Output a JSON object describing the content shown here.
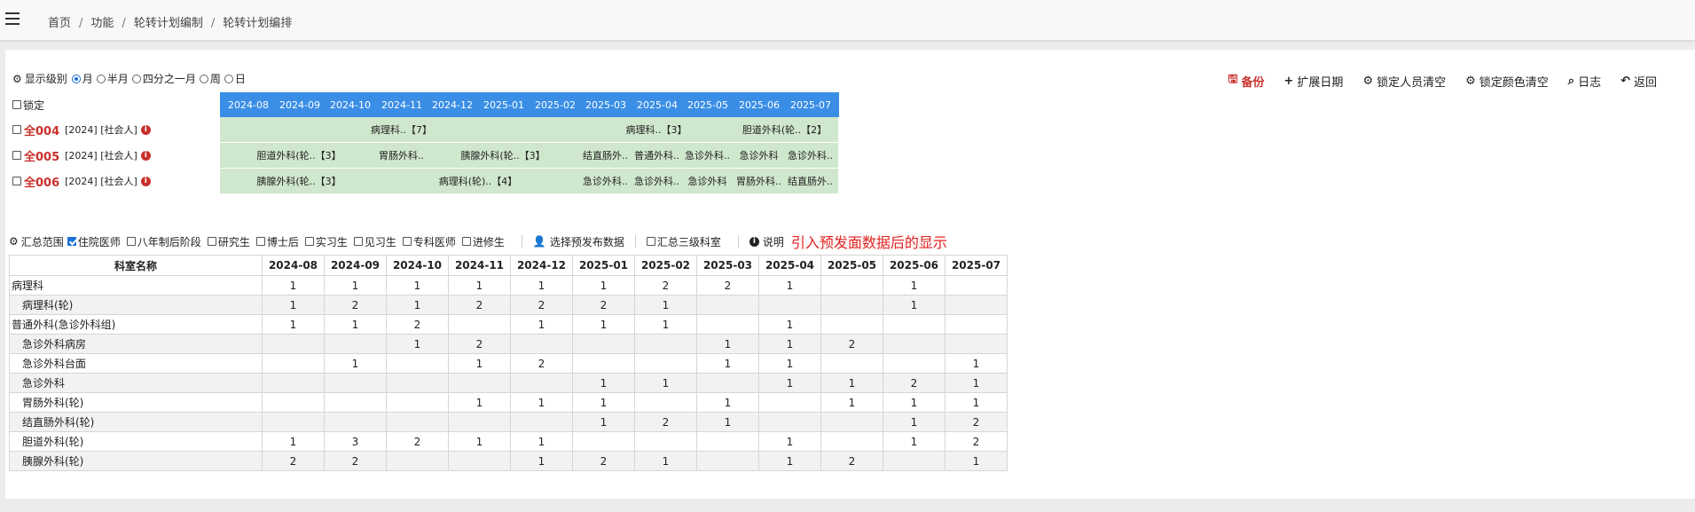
{
  "breadcrumb": [
    "首页",
    "功能",
    "轮转计划编制",
    "轮转计划编排"
  ],
  "toolbar": {
    "level_label": "显示级别",
    "levels": [
      "月",
      "半月",
      "四分之一月",
      "周",
      "日"
    ],
    "selected_level": "月",
    "actions": [
      {
        "icon": "save-icon",
        "label": "备份"
      },
      {
        "icon": "plus-icon",
        "label": "扩展日期"
      },
      {
        "icon": "gear-icon",
        "label": "锁定人员清空"
      },
      {
        "icon": "gear-icon",
        "label": "锁定颜色清空"
      },
      {
        "icon": "search-icon",
        "label": "日志"
      },
      {
        "icon": "back-icon",
        "label": "返回"
      }
    ]
  },
  "lock_label": "锁定",
  "months": [
    "2024-08",
    "2024-09",
    "2024-10",
    "2024-11",
    "2024-12",
    "2025-01",
    "2025-02",
    "2025-03",
    "2025-04",
    "2025-05",
    "2025-06",
    "2025-07"
  ],
  "staff": [
    {
      "code": "全004",
      "meta": "[2024] [社会人]",
      "slots": [
        {
          "label": "病理科..【7】",
          "start": 0,
          "span": 7
        },
        {
          "label": "病理科..【3】",
          "start": 7,
          "span": 3
        },
        {
          "label": "胆道外科(轮..【2】",
          "start": 10,
          "span": 2
        }
      ]
    },
    {
      "code": "全005",
      "meta": "[2024] [社会人]",
      "slots": [
        {
          "label": "胆道外科(轮..【3】",
          "start": 0,
          "span": 3
        },
        {
          "label": "胃肠外科..",
          "start": 3,
          "span": 1
        },
        {
          "label": "胰腺外科(轮..【3】",
          "start": 4,
          "span": 3
        },
        {
          "label": "结直肠外..",
          "start": 7,
          "span": 1
        },
        {
          "label": "普通外科..",
          "start": 8,
          "span": 1
        },
        {
          "label": "急诊外科..",
          "start": 9,
          "span": 1
        },
        {
          "label": "急诊外科",
          "start": 10,
          "span": 1
        },
        {
          "label": "急诊外科..",
          "start": 11,
          "span": 1
        }
      ]
    },
    {
      "code": "全006",
      "meta": "[2024] [社会人]",
      "slots": [
        {
          "label": "胰腺外科(轮..【3】",
          "start": 0,
          "span": 3
        },
        {
          "label": "病理科(轮)..【4】",
          "start": 3,
          "span": 4
        },
        {
          "label": "急诊外科..",
          "start": 7,
          "span": 1
        },
        {
          "label": "急诊外科..",
          "start": 8,
          "span": 1
        },
        {
          "label": "急诊外科",
          "start": 9,
          "span": 1
        },
        {
          "label": "胃肠外科..",
          "start": 10,
          "span": 1
        },
        {
          "label": "结直肠外..",
          "start": 11,
          "span": 1
        }
      ]
    }
  ],
  "summary": {
    "label": "汇总范围",
    "options": [
      {
        "label": "住院医师",
        "checked": true
      },
      {
        "label": "八年制后阶段",
        "checked": false
      },
      {
        "label": "研究生",
        "checked": false
      },
      {
        "label": "博士后",
        "checked": false
      },
      {
        "label": "实习生",
        "checked": false
      },
      {
        "label": "见习生",
        "checked": false
      },
      {
        "label": "专科医师",
        "checked": false
      },
      {
        "label": "进修生",
        "checked": false
      }
    ],
    "select_button": "选择预发布数据",
    "three_level": "汇总三级科室",
    "explain": "说明",
    "note": "引入预发面数据后的显示"
  },
  "table": {
    "name_header": "科室名称",
    "rows": [
      {
        "name": "病理科",
        "sub": false,
        "values": [
          "1",
          "1",
          "1",
          "1",
          "1",
          "1",
          "2",
          "2",
          "1",
          "",
          "1",
          ""
        ]
      },
      {
        "name": "病理科(轮)",
        "sub": true,
        "values": [
          "1",
          "2",
          "1",
          "2",
          "2",
          "2",
          "1",
          "",
          "",
          "",
          "1",
          ""
        ]
      },
      {
        "name": "普通外科(急诊外科组)",
        "sub": false,
        "values": [
          "1",
          "1",
          "2",
          "",
          "1",
          "1",
          "1",
          "",
          "1",
          "",
          "",
          ""
        ]
      },
      {
        "name": "急诊外科病房",
        "sub": true,
        "values": [
          "",
          "",
          "1",
          "2",
          "",
          "",
          "",
          "1",
          "1",
          "2",
          "",
          ""
        ]
      },
      {
        "name": "急诊外科台面",
        "sub": true,
        "values": [
          "",
          "1",
          "",
          "1",
          "2",
          "",
          "",
          "1",
          "1",
          "",
          "",
          "1"
        ]
      },
      {
        "name": "急诊外科",
        "sub": true,
        "values": [
          "",
          "",
          "",
          "",
          "",
          "1",
          "1",
          "",
          "1",
          "1",
          "2",
          "1"
        ]
      },
      {
        "name": "胃肠外科(轮)",
        "sub": true,
        "values": [
          "",
          "",
          "",
          "1",
          "1",
          "1",
          "",
          "1",
          "",
          "1",
          "1",
          "1"
        ]
      },
      {
        "name": "结直肠外科(轮)",
        "sub": true,
        "values": [
          "",
          "",
          "",
          "",
          "",
          "1",
          "2",
          "1",
          "",
          "",
          "1",
          "2"
        ]
      },
      {
        "name": "胆道外科(轮)",
        "sub": true,
        "values": [
          "1",
          "3",
          "2",
          "1",
          "1",
          "",
          "",
          "",
          "1",
          "",
          "1",
          "2"
        ]
      },
      {
        "name": "胰腺外科(轮)",
        "sub": true,
        "values": [
          "2",
          "2",
          "",
          "",
          "1",
          "2",
          "1",
          "",
          "1",
          "2",
          "",
          "1"
        ]
      }
    ]
  }
}
